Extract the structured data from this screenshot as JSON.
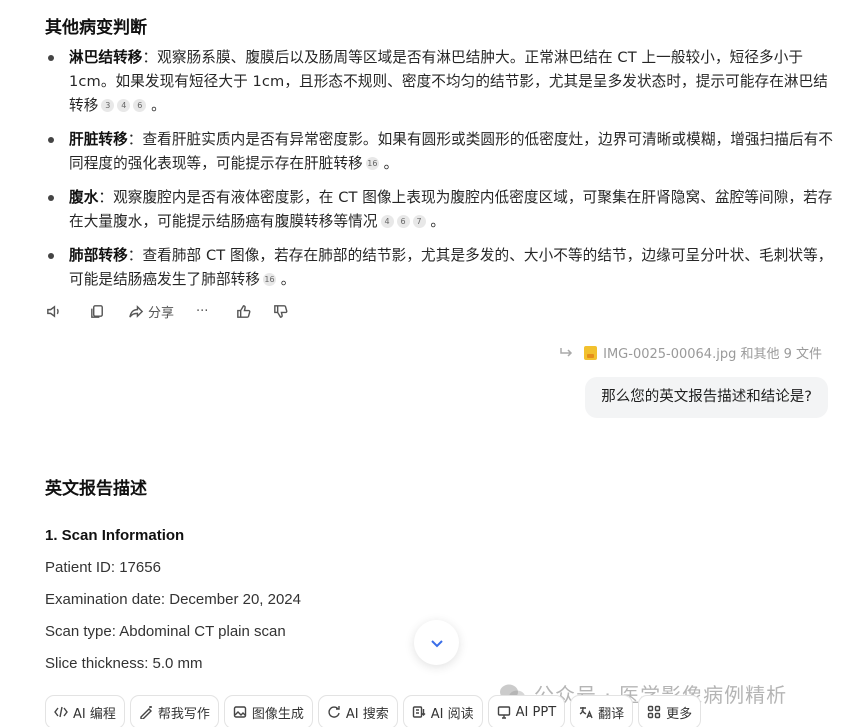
{
  "section1": {
    "title": "其他病变判断",
    "bullets": [
      {
        "term": "淋巴结转移",
        "text": "：观察肠系膜、腹膜后以及肠周等区域是否有淋巴结肿大。正常淋巴结在 CT 上一般较小，短径多小于 1cm。如果发现有短径大于 1cm，且形态不规则、密度不均匀的结节影，尤其是呈多发状态时，提示可能存在淋巴结转移",
        "cites": [
          "3",
          "4",
          "6"
        ],
        "end": "。"
      },
      {
        "term": "肝脏转移",
        "text": "：查看肝脏实质内是否有异常密度影。如果有圆形或类圆形的低密度灶，边界可清晰或模糊，增强扫描后有不同程度的强化表现等，可能提示存在肝脏转移",
        "cites": [
          "16"
        ],
        "end": "。"
      },
      {
        "term": "腹水",
        "text": "：观察腹腔内是否有液体密度影，在 CT 图像上表现为腹腔内低密度区域，可聚集在肝肾隐窝、盆腔等间隙，若存在大量腹水，可能提示结肠癌有腹膜转移等情况",
        "cites": [
          "4",
          "6",
          "7"
        ],
        "end": "。"
      },
      {
        "term": "肺部转移",
        "text": "：查看肺部 CT 图像，若存在肺部的结节影，尤其是多发的、大小不等的结节，边缘可呈分叶状、毛刺状等，可能是结肠癌发生了肺部转移",
        "cites": [
          "16"
        ],
        "end": "。"
      }
    ]
  },
  "actions": {
    "share_label": "分享",
    "more_label": "···"
  },
  "file_ref": {
    "text": "IMG-0025-00064.jpg 和其他 9 文件"
  },
  "user_message": "那么您的英文报告描述和结论是?",
  "section2": {
    "title": "英文报告描述",
    "sub_head": "1. Scan Information",
    "lines": [
      "Patient ID: 17656",
      "Examination date: December 20, 2024",
      "Scan type: Abdominal CT plain scan",
      "Slice thickness: 5.0 mm"
    ]
  },
  "watermark": "公众号 · 医学影像病例精析",
  "chips": [
    "AI 编程",
    "帮我写作",
    "图像生成",
    "AI 搜索",
    "AI 阅读",
    "AI PPT",
    "翻译",
    "更多"
  ],
  "colors": {
    "accent": "#3a6ee8",
    "bubble_bg": "#f3f4f5",
    "cite_bg": "#e8e8e8",
    "file_icon": "#f2c12e"
  }
}
